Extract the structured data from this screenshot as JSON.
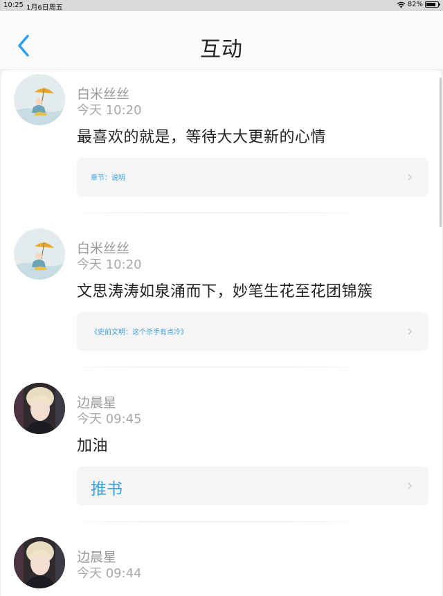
{
  "status_bar": {
    "time": "10:25",
    "date": "1月6日周五",
    "battery": "82%",
    "battery_level": 0.82
  },
  "nav": {
    "title": "互动"
  },
  "comments": [
    {
      "user": "白米丝丝",
      "time": "今天 10:20",
      "text": "最喜欢的就是，等待大大更新的心情",
      "link": "章节：说明",
      "avatar": "umbrella-girl-avatar"
    },
    {
      "user": "白米丝丝",
      "time": "今天 10:20",
      "text": "文思涛涛如泉涌而下，妙笔生花至花团锦簇",
      "link": "《史前文明：这个杀手有点冷》",
      "avatar": "umbrella-girl-avatar"
    },
    {
      "user": "边晨星",
      "time": "今天 09:45",
      "text": "加油",
      "link": "推书",
      "avatar": "blonde-person-avatar"
    },
    {
      "user": "边晨星",
      "time": "今天 09:44",
      "avatar": "blonde-person-avatar"
    }
  ],
  "colors": {
    "accent": "#3aa0e0",
    "back": "#2a9df4"
  }
}
